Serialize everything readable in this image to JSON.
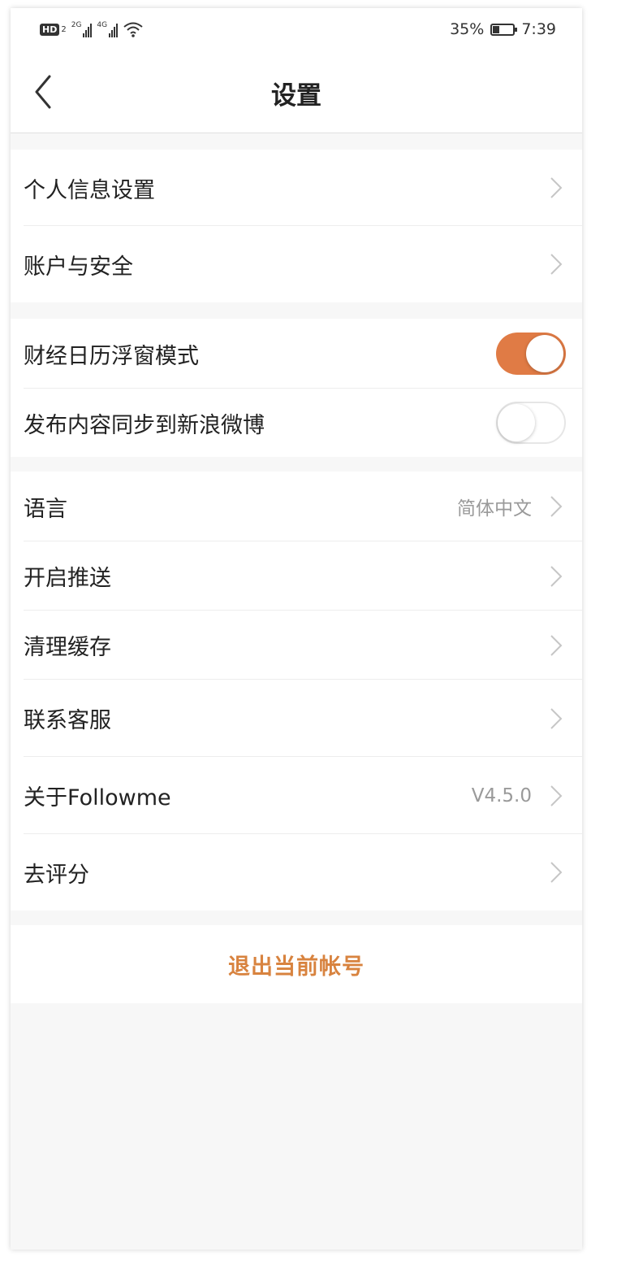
{
  "status_bar": {
    "hd_badge": "HD",
    "sim_badge": "2",
    "net1": "2G",
    "net2": "4G",
    "battery_percent_text": "35%",
    "battery_level": 0.35,
    "time": "7:39"
  },
  "header": {
    "title": "设置"
  },
  "groups": {
    "account": [
      {
        "label": "个人信息设置"
      },
      {
        "label": "账户与安全"
      }
    ],
    "toggles": [
      {
        "label": "财经日历浮窗模式",
        "enabled": true
      },
      {
        "label": "发布内容同步到新浪微博",
        "enabled": false
      }
    ],
    "general": [
      {
        "label": "语言",
        "value": "简体中文"
      },
      {
        "label": "开启推送",
        "value": ""
      },
      {
        "label": "清理缓存",
        "value": ""
      },
      {
        "label": "联系客服",
        "value": ""
      },
      {
        "label": "关于Followme",
        "value": "V4.5.0"
      },
      {
        "label": "去评分",
        "value": ""
      }
    ]
  },
  "logout": {
    "label": "退出当前帐号"
  },
  "colors": {
    "accent": "#e07b45",
    "logout_text": "#d8833f",
    "background": "#f7f7f7"
  }
}
